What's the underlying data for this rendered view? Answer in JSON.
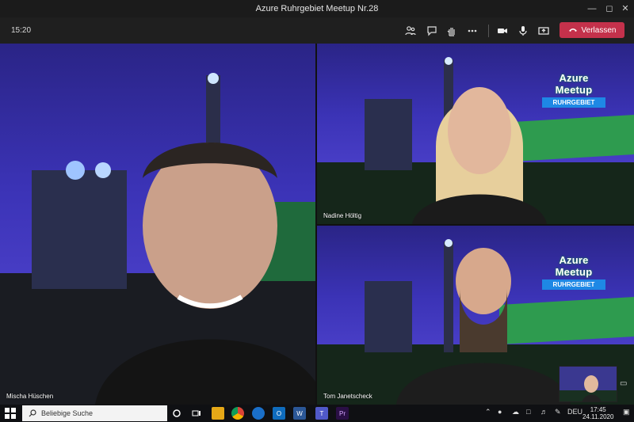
{
  "window": {
    "title": "Azure Ruhrgebiet Meetup Nr.28"
  },
  "toolbar": {
    "time": "15:20",
    "leave_label": "Verlassen",
    "icons": [
      "participants-icon",
      "chat-icon",
      "raise-hand-icon",
      "more-icon",
      "camera-icon",
      "microphone-icon",
      "share-screen-icon"
    ]
  },
  "participants": [
    {
      "name": "Mischa Hüschen"
    },
    {
      "name": "Nadine Höltig"
    },
    {
      "name": "Tom Janetscheck"
    }
  ],
  "branding": {
    "line1": "Azure Meetup",
    "line2": "RUHRGEBIET"
  },
  "taskbar": {
    "search_placeholder": "Beliebige Suche",
    "language": "DEU",
    "time": "17:45",
    "date": "24.11.2020"
  },
  "colors": {
    "leave": "#c4314b",
    "accent": "#1e88e5"
  }
}
